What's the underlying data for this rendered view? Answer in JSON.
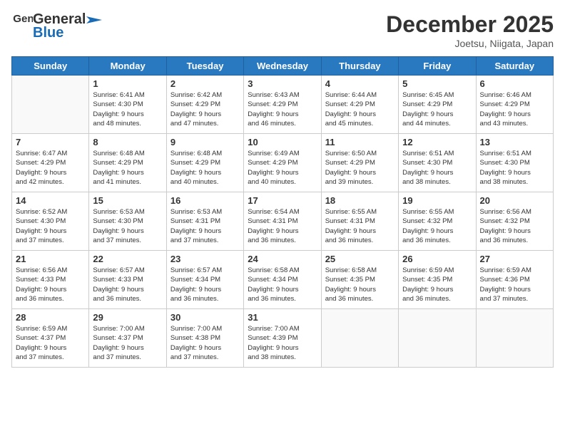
{
  "header": {
    "logo_general": "General",
    "logo_blue": "Blue",
    "title": "December 2025",
    "location": "Joetsu, Niigata, Japan"
  },
  "weekdays": [
    "Sunday",
    "Monday",
    "Tuesday",
    "Wednesday",
    "Thursday",
    "Friday",
    "Saturday"
  ],
  "weeks": [
    [
      {
        "day": "",
        "sunrise": "",
        "sunset": "",
        "daylight": ""
      },
      {
        "day": "1",
        "sunrise": "Sunrise: 6:41 AM",
        "sunset": "Sunset: 4:30 PM",
        "daylight": "Daylight: 9 hours and 48 minutes."
      },
      {
        "day": "2",
        "sunrise": "Sunrise: 6:42 AM",
        "sunset": "Sunset: 4:29 PM",
        "daylight": "Daylight: 9 hours and 47 minutes."
      },
      {
        "day": "3",
        "sunrise": "Sunrise: 6:43 AM",
        "sunset": "Sunset: 4:29 PM",
        "daylight": "Daylight: 9 hours and 46 minutes."
      },
      {
        "day": "4",
        "sunrise": "Sunrise: 6:44 AM",
        "sunset": "Sunset: 4:29 PM",
        "daylight": "Daylight: 9 hours and 45 minutes."
      },
      {
        "day": "5",
        "sunrise": "Sunrise: 6:45 AM",
        "sunset": "Sunset: 4:29 PM",
        "daylight": "Daylight: 9 hours and 44 minutes."
      },
      {
        "day": "6",
        "sunrise": "Sunrise: 6:46 AM",
        "sunset": "Sunset: 4:29 PM",
        "daylight": "Daylight: 9 hours and 43 minutes."
      }
    ],
    [
      {
        "day": "7",
        "sunrise": "Sunrise: 6:47 AM",
        "sunset": "Sunset: 4:29 PM",
        "daylight": "Daylight: 9 hours and 42 minutes."
      },
      {
        "day": "8",
        "sunrise": "Sunrise: 6:48 AM",
        "sunset": "Sunset: 4:29 PM",
        "daylight": "Daylight: 9 hours and 41 minutes."
      },
      {
        "day": "9",
        "sunrise": "Sunrise: 6:48 AM",
        "sunset": "Sunset: 4:29 PM",
        "daylight": "Daylight: 9 hours and 40 minutes."
      },
      {
        "day": "10",
        "sunrise": "Sunrise: 6:49 AM",
        "sunset": "Sunset: 4:29 PM",
        "daylight": "Daylight: 9 hours and 40 minutes."
      },
      {
        "day": "11",
        "sunrise": "Sunrise: 6:50 AM",
        "sunset": "Sunset: 4:29 PM",
        "daylight": "Daylight: 9 hours and 39 minutes."
      },
      {
        "day": "12",
        "sunrise": "Sunrise: 6:51 AM",
        "sunset": "Sunset: 4:30 PM",
        "daylight": "Daylight: 9 hours and 38 minutes."
      },
      {
        "day": "13",
        "sunrise": "Sunrise: 6:51 AM",
        "sunset": "Sunset: 4:30 PM",
        "daylight": "Daylight: 9 hours and 38 minutes."
      }
    ],
    [
      {
        "day": "14",
        "sunrise": "Sunrise: 6:52 AM",
        "sunset": "Sunset: 4:30 PM",
        "daylight": "Daylight: 9 hours and 37 minutes."
      },
      {
        "day": "15",
        "sunrise": "Sunrise: 6:53 AM",
        "sunset": "Sunset: 4:30 PM",
        "daylight": "Daylight: 9 hours and 37 minutes."
      },
      {
        "day": "16",
        "sunrise": "Sunrise: 6:53 AM",
        "sunset": "Sunset: 4:31 PM",
        "daylight": "Daylight: 9 hours and 37 minutes."
      },
      {
        "day": "17",
        "sunrise": "Sunrise: 6:54 AM",
        "sunset": "Sunset: 4:31 PM",
        "daylight": "Daylight: 9 hours and 36 minutes."
      },
      {
        "day": "18",
        "sunrise": "Sunrise: 6:55 AM",
        "sunset": "Sunset: 4:31 PM",
        "daylight": "Daylight: 9 hours and 36 minutes."
      },
      {
        "day": "19",
        "sunrise": "Sunrise: 6:55 AM",
        "sunset": "Sunset: 4:32 PM",
        "daylight": "Daylight: 9 hours and 36 minutes."
      },
      {
        "day": "20",
        "sunrise": "Sunrise: 6:56 AM",
        "sunset": "Sunset: 4:32 PM",
        "daylight": "Daylight: 9 hours and 36 minutes."
      }
    ],
    [
      {
        "day": "21",
        "sunrise": "Sunrise: 6:56 AM",
        "sunset": "Sunset: 4:33 PM",
        "daylight": "Daylight: 9 hours and 36 minutes."
      },
      {
        "day": "22",
        "sunrise": "Sunrise: 6:57 AM",
        "sunset": "Sunset: 4:33 PM",
        "daylight": "Daylight: 9 hours and 36 minutes."
      },
      {
        "day": "23",
        "sunrise": "Sunrise: 6:57 AM",
        "sunset": "Sunset: 4:34 PM",
        "daylight": "Daylight: 9 hours and 36 minutes."
      },
      {
        "day": "24",
        "sunrise": "Sunrise: 6:58 AM",
        "sunset": "Sunset: 4:34 PM",
        "daylight": "Daylight: 9 hours and 36 minutes."
      },
      {
        "day": "25",
        "sunrise": "Sunrise: 6:58 AM",
        "sunset": "Sunset: 4:35 PM",
        "daylight": "Daylight: 9 hours and 36 minutes."
      },
      {
        "day": "26",
        "sunrise": "Sunrise: 6:59 AM",
        "sunset": "Sunset: 4:35 PM",
        "daylight": "Daylight: 9 hours and 36 minutes."
      },
      {
        "day": "27",
        "sunrise": "Sunrise: 6:59 AM",
        "sunset": "Sunset: 4:36 PM",
        "daylight": "Daylight: 9 hours and 37 minutes."
      }
    ],
    [
      {
        "day": "28",
        "sunrise": "Sunrise: 6:59 AM",
        "sunset": "Sunset: 4:37 PM",
        "daylight": "Daylight: 9 hours and 37 minutes."
      },
      {
        "day": "29",
        "sunrise": "Sunrise: 7:00 AM",
        "sunset": "Sunset: 4:37 PM",
        "daylight": "Daylight: 9 hours and 37 minutes."
      },
      {
        "day": "30",
        "sunrise": "Sunrise: 7:00 AM",
        "sunset": "Sunset: 4:38 PM",
        "daylight": "Daylight: 9 hours and 37 minutes."
      },
      {
        "day": "31",
        "sunrise": "Sunrise: 7:00 AM",
        "sunset": "Sunset: 4:39 PM",
        "daylight": "Daylight: 9 hours and 38 minutes."
      },
      {
        "day": "",
        "sunrise": "",
        "sunset": "",
        "daylight": ""
      },
      {
        "day": "",
        "sunrise": "",
        "sunset": "",
        "daylight": ""
      },
      {
        "day": "",
        "sunrise": "",
        "sunset": "",
        "daylight": ""
      }
    ]
  ]
}
